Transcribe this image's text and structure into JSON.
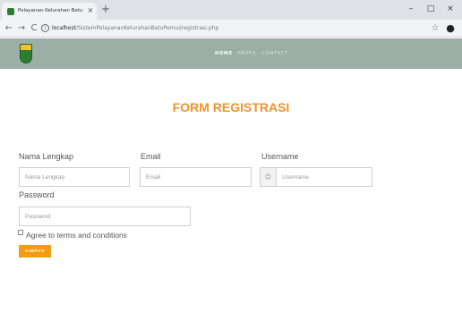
{
  "browser": {
    "tab_title": "Pelayanan Kelurahan Batu Pemi...",
    "tab_close": "×",
    "new_tab": "+",
    "minimize": "–",
    "maximize": "□",
    "close": "×",
    "back": "←",
    "forward": "→",
    "reload": "C",
    "url_host": "localhost",
    "url_path": "/SistemPelayananKelurahanBatuPemui/registrasi.php"
  },
  "site": {
    "menu": [
      "HOME",
      "PROFIL",
      "CONTACT"
    ]
  },
  "form": {
    "title": "FORM REGISTRASI",
    "nama_label": "Nama Lengkap",
    "nama_placeholder": "Nama Lengkap",
    "email_label": "Email",
    "email_placeholder": "Email",
    "username_label": "Username",
    "username_placeholder": "Username",
    "password_label": "Password",
    "password_placeholder": "Password",
    "terms_label": "Agree to terms and conditions",
    "submit_label": "SIMPAN"
  },
  "icons": {
    "user": "☺",
    "star": "☆",
    "profile": "●",
    "info": "i"
  },
  "colors": {
    "accent": "#f0932b",
    "button": "#f39c12",
    "navbar": "#9cafa6"
  }
}
